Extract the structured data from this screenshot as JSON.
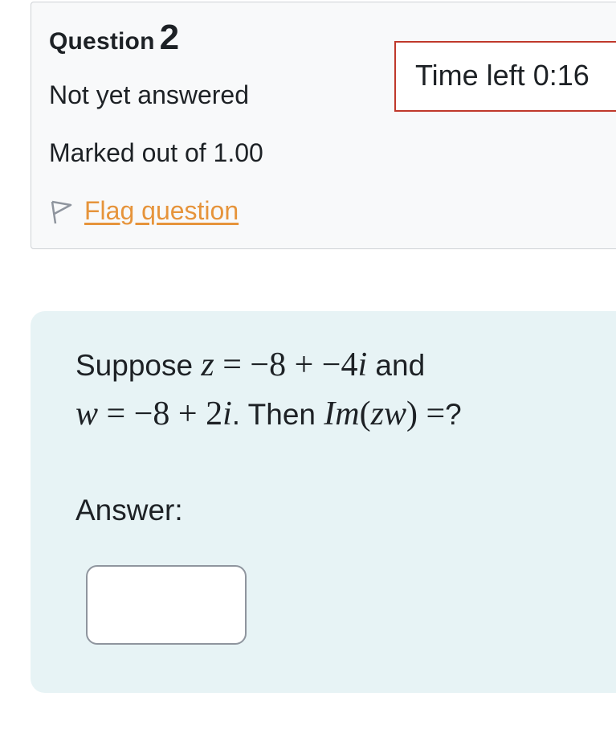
{
  "info": {
    "question_label": "Question",
    "question_number": "2",
    "state": "Not yet answered",
    "grade": "Marked out of 1.00",
    "flag_label": "Flag question"
  },
  "timer": {
    "text": "Time left 0:16"
  },
  "question": {
    "suppose": "Suppose",
    "z_var": "z",
    "eq1": " = −8 + −4",
    "i1": "i",
    "and": " and",
    "w_var": "w",
    "eq2": " = −8 + 2",
    "i2": "i",
    "period": ". ",
    "then": "Then",
    "im": "Im",
    "paren_open": "(",
    "zw": "zw",
    "paren_close": ")",
    "eq3": " =",
    "question_mark": "?"
  },
  "answer": {
    "label": "Answer:",
    "value": ""
  },
  "colors": {
    "flag_orange": "#e6943b",
    "timer_border": "#c0392b",
    "formulation_bg": "#e7f3f5",
    "info_bg": "#f8f9fa"
  }
}
